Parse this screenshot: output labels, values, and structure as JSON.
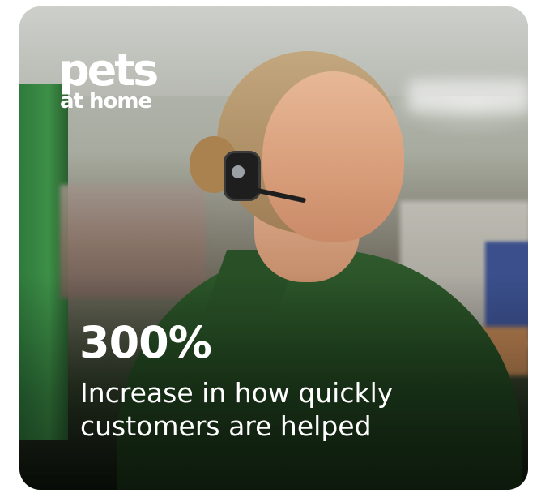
{
  "card": {
    "image_alt_subject": "photo",
    "logo": {
      "line1": "pets",
      "line2": "at home"
    },
    "stat": {
      "value": "300%",
      "caption": "Increase in how quickly customers are helped"
    }
  },
  "colors": {
    "text": "#ffffff",
    "uniform_green": "#2f5a2c",
    "shelf_green": "#3d8f47"
  }
}
